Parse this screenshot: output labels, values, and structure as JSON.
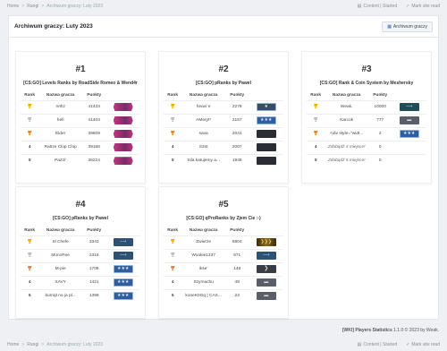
{
  "breadcrumb": {
    "home": "Home",
    "sep": ">",
    "rangi": "Rangi",
    "current": "Archiwum graczy: Luty 2023"
  },
  "topbar": {
    "content": "Content | Started",
    "mark": "Mark site read"
  },
  "panel": {
    "title": "Archiwum graczy: Luty 2023",
    "archive_btn": "Archiwum graczy"
  },
  "headers": {
    "rank": "Rank",
    "name": "Nazwa gracza",
    "points": "Punkty"
  },
  "cards": [
    {
      "no": "#1",
      "system": "[CS:GO] Levels Ranks by RoadSide Romeo & Wend4r",
      "rows": [
        {
          "rank": "",
          "trophy": "gold",
          "name": "rvthz",
          "points": "41433",
          "badge": "pink"
        },
        {
          "rank": "",
          "trophy": "silver",
          "name": "hefi",
          "points": "41403",
          "badge": "pink"
        },
        {
          "rank": "",
          "trophy": "bronze",
          "name": "Elder",
          "points": "39809",
          "badge": "pink"
        },
        {
          "rank": "4",
          "trophy": "",
          "name": "Ra5ze Clop Clop",
          "points": "39168",
          "badge": "pink"
        },
        {
          "rank": "5",
          "trophy": "",
          "name": "PaZzi'",
          "points": "36224",
          "badge": "pink"
        }
      ]
    },
    {
      "no": "#2",
      "system": "[CS:GO] pRanks by Pawel",
      "rows": [
        {
          "rank": "",
          "trophy": "gold",
          "name": "heavi`e",
          "points": "2278",
          "badge": "redstar"
        },
        {
          "rank": "",
          "trophy": "silver",
          "name": "AMeryt*",
          "points": "2157",
          "badge": "bluestar"
        },
        {
          "rank": "",
          "trophy": "bronze",
          "name": "sava",
          "points": "2041",
          "badge": "dark"
        },
        {
          "rank": "4",
          "trophy": "",
          "name": "S3nt",
          "points": "2007",
          "badge": "dark"
        },
        {
          "rank": "5",
          "trophy": "",
          "name": "Sila katujemy a...",
          "points": "1946",
          "badge": "dark"
        }
      ]
    },
    {
      "no": "#3",
      "system": "[CS:GO] Rank & Coin System by Meshersky",
      "rows": [
        {
          "rank": "",
          "trophy": "gold",
          "name": "Weak.",
          "points": "10000",
          "badge": "teal"
        },
        {
          "rank": "",
          "trophy": "silver",
          "name": "Karcok",
          "points": "777",
          "badge": "grey"
        },
        {
          "rank": "",
          "trophy": "bronze",
          "name": "<div style=\"widt...",
          "points": "2",
          "badge": "bluestar"
        },
        {
          "rank": "4",
          "trophy": "",
          "name": "Zdobądź 4 miejsce!",
          "points": "0",
          "badge": "",
          "italic": true
        },
        {
          "rank": "5",
          "trophy": "",
          "name": "Zdobądź 5 miejsce!",
          "points": "0",
          "badge": "",
          "italic": true
        }
      ]
    },
    {
      "no": "#4",
      "system": "[CS:GO] pRanks by Pawel",
      "rows": [
        {
          "rank": "",
          "trophy": "gold",
          "name": "Sl Chefe",
          "points": "3341",
          "badge": "bluegun"
        },
        {
          "rank": "",
          "trophy": "silver",
          "name": "MoncRee",
          "points": "2316",
          "badge": "bluegun"
        },
        {
          "rank": "",
          "trophy": "bronze",
          "name": "M-pie",
          "points": "1708",
          "badge": "bluestar"
        },
        {
          "rank": "4",
          "trophy": "",
          "name": "XAVY",
          "points": "1421",
          "badge": "bluestar"
        },
        {
          "rank": "5",
          "trophy": "",
          "name": "kurrajt no ja pl...",
          "points": "1399",
          "badge": "bluestar"
        }
      ]
    },
    {
      "no": "#5",
      "system": "[CS:GO] qProRanks by Zjem Cie :-)",
      "rows": [
        {
          "rank": "",
          "trophy": "gold",
          "name": "Zwierze",
          "points": "6804",
          "badge": "gold"
        },
        {
          "rank": "",
          "trophy": "silver",
          "name": "Wookie1337",
          "points": "671",
          "badge": "bluegun"
        },
        {
          "rank": "",
          "trophy": "bronze",
          "name": "ikse'",
          "points": "148",
          "badge": "chev"
        },
        {
          "rank": "4",
          "trophy": "",
          "name": "Szymachu",
          "points": "48",
          "badge": "grey"
        },
        {
          "rank": "5",
          "trophy": "",
          "name": "koneK0Gq | CAS...",
          "points": "23",
          "badge": "grey"
        }
      ]
    }
  ],
  "footer": {
    "brand": "[WKI] Players Statistics",
    "version": "1.1.0 © 2023 by Weak."
  },
  "colors": {
    "trophy_gold": "#f0b400",
    "trophy_silver": "#b8bec6",
    "trophy_bronze": "#d98a3a",
    "badge_pink": "#c2367d",
    "badge_redstar": "#3a4a6a",
    "badge_bluestar": "#2f5d9e",
    "badge_dark": "#2a2d33",
    "badge_teal": "#1f4d57",
    "badge_grey": "#5a5e66",
    "badge_bluegun": "#2f5274",
    "badge_gold": "#8a6a1c",
    "badge_chev": "#3a3d44"
  }
}
